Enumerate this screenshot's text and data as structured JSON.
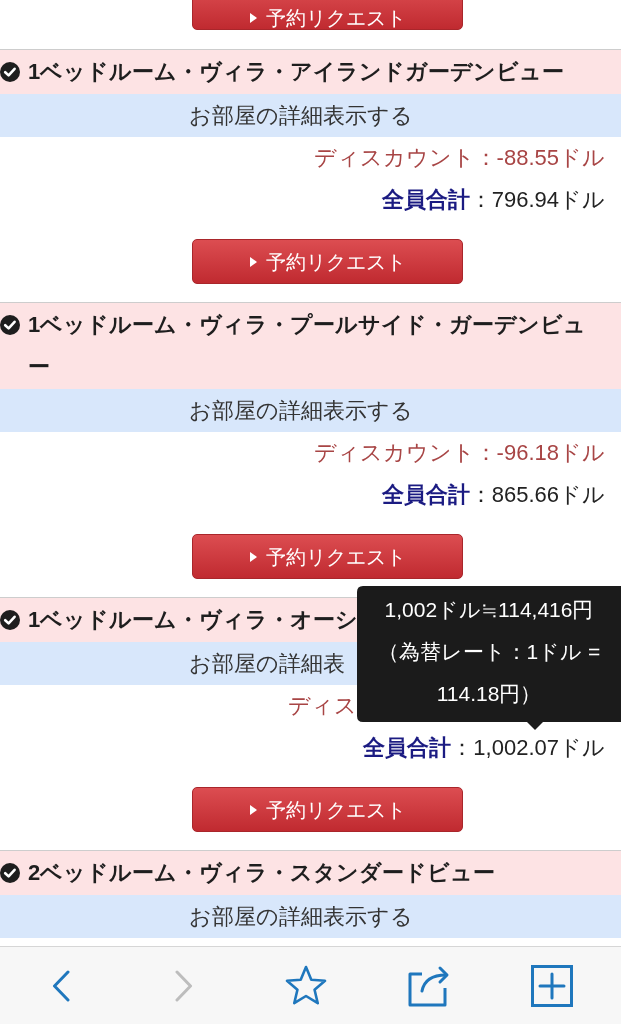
{
  "previous_room": {
    "button": "予約リクエスト"
  },
  "rooms": [
    {
      "title": "1ベッドルーム・ヴィラ・アイランドガーデンビュー",
      "details": "お部屋の詳細表示する",
      "discount": "ディスカウント：-88.55ドル",
      "total_label": "全員合計",
      "total_amount": "：796.94ドル",
      "button": "予約リクエスト"
    },
    {
      "title": "1ベッドルーム・ヴィラ・プールサイド・ガーデンビュー",
      "details": "お部屋の詳細表示する",
      "discount": "ディスカウント：-96.18ドル",
      "total_label": "全員合計",
      "total_amount": "：865.66ドル",
      "button": "予約リクエスト"
    },
    {
      "title": "1ベッドルーム・ヴィラ・オーシ",
      "details": "お部屋の詳細表",
      "discount": "ディス",
      "total_label": "全員合計",
      "total_amount": "：1,002.07ドル",
      "button": "予約リクエスト",
      "tooltip": {
        "amount": "1,002ドル≒114,416円",
        "rate": "（為替レート：1ドル = 114.18円）"
      }
    },
    {
      "title": "2ベッドルーム・ヴィラ・スタンダードビュー",
      "details": "お部屋の詳細表示する"
    }
  ],
  "toolbar": {
    "items": [
      {
        "kind": "back",
        "disabled": false
      },
      {
        "kind": "forward",
        "disabled": true
      },
      {
        "kind": "star",
        "disabled": false
      },
      {
        "kind": "share",
        "disabled": false
      },
      {
        "kind": "add",
        "disabled": false
      }
    ]
  }
}
